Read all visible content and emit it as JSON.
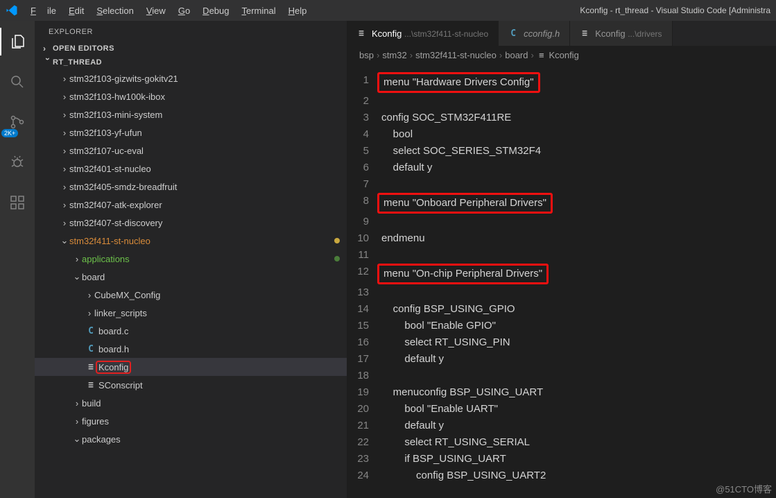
{
  "window": {
    "title": "Kconfig - rt_thread - Visual Studio Code [Administra"
  },
  "menu": {
    "file": "File",
    "edit": "Edit",
    "selection": "Selection",
    "view": "View",
    "go": "Go",
    "debug": "Debug",
    "terminal": "Terminal",
    "help": "Help"
  },
  "activity": {
    "scm_badge": "2K+"
  },
  "explorer": {
    "title": "EXPLORER",
    "open_editors": "OPEN EDITORS",
    "root": "RT_THREAD",
    "tree": [
      {
        "i": 2,
        "tw": ">",
        "txt": "stm32f103-gizwits-gokitv21"
      },
      {
        "i": 2,
        "tw": ">",
        "txt": "stm32f103-hw100k-ibox"
      },
      {
        "i": 2,
        "tw": ">",
        "txt": "stm32f103-mini-system"
      },
      {
        "i": 2,
        "tw": ">",
        "txt": "stm32f103-yf-ufun"
      },
      {
        "i": 2,
        "tw": ">",
        "txt": "stm32f107-uc-eval"
      },
      {
        "i": 2,
        "tw": ">",
        "txt": "stm32f401-st-nucleo"
      },
      {
        "i": 2,
        "tw": ">",
        "txt": "stm32f405-smdz-breadfruit"
      },
      {
        "i": 2,
        "tw": ">",
        "txt": "stm32f407-atk-explorer"
      },
      {
        "i": 2,
        "tw": ">",
        "txt": "stm32f407-st-discovery"
      },
      {
        "i": 2,
        "tw": "v",
        "txt": "stm32f411-st-nucleo",
        "cls": "hl-orange",
        "dot": "dot-y"
      },
      {
        "i": 3,
        "tw": ">",
        "txt": "applications",
        "cls": "hl-green",
        "dot": "dot-g"
      },
      {
        "i": 3,
        "tw": "v",
        "txt": "board"
      },
      {
        "i": 4,
        "tw": ">",
        "txt": "CubeMX_Config"
      },
      {
        "i": 4,
        "tw": ">",
        "txt": "linker_scripts"
      },
      {
        "i": 4,
        "ic": "C",
        "icc": "#519aba",
        "txt": "board.c"
      },
      {
        "i": 4,
        "ic": "C",
        "icc": "#519aba",
        "txt": "board.h"
      },
      {
        "i": 4,
        "ic": "≡",
        "icc": "#c5c5c5",
        "txt": "Kconfig",
        "sel": true,
        "box": true
      },
      {
        "i": 4,
        "ic": "≡",
        "icc": "#c5c5c5",
        "txt": "SConscript"
      },
      {
        "i": 3,
        "tw": ">",
        "txt": "build"
      },
      {
        "i": 3,
        "tw": ">",
        "txt": "figures"
      },
      {
        "i": 3,
        "tw": "v",
        "txt": "packages"
      }
    ]
  },
  "tabs": [
    {
      "ic": "≡",
      "icc": "#c5c5c5",
      "label": "Kconfig",
      "suffix": "...\\stm32f411-st-nucleo",
      "active": true
    },
    {
      "ic": "C",
      "icc": "#519aba",
      "label": "cconfig.h",
      "italic": true
    },
    {
      "ic": "≡",
      "icc": "#c5c5c5",
      "label": "Kconfig",
      "suffix": "...\\drivers"
    }
  ],
  "breadcrumbs": [
    "bsp",
    "stm32",
    "stm32f411-st-nucleo",
    "board",
    "Kconfig"
  ],
  "code": [
    {
      "n": 1,
      "t": "menu \"Hardware Drivers Config\"",
      "box": true,
      "ind": 0
    },
    {
      "n": 2,
      "t": "",
      "ind": 0
    },
    {
      "n": 3,
      "t": "config SOC_STM32F411RE",
      "ind": 0
    },
    {
      "n": 4,
      "t": "    bool",
      "ind": 0
    },
    {
      "n": 5,
      "t": "    select SOC_SERIES_STM32F4",
      "ind": 0
    },
    {
      "n": 6,
      "t": "    default y",
      "ind": 0
    },
    {
      "n": 7,
      "t": "",
      "ind": 0
    },
    {
      "n": 8,
      "t": "menu \"Onboard Peripheral Drivers\"",
      "box": true,
      "ind": 0
    },
    {
      "n": 9,
      "t": "",
      "ind": 0
    },
    {
      "n": 10,
      "t": "endmenu",
      "ind": 0
    },
    {
      "n": 11,
      "t": "",
      "ind": 0
    },
    {
      "n": 12,
      "t": "menu \"On-chip Peripheral Drivers\"",
      "box": true,
      "ind": 0
    },
    {
      "n": 13,
      "t": "",
      "ind": 0
    },
    {
      "n": 14,
      "t": "    config BSP_USING_GPIO",
      "ind": 0
    },
    {
      "n": 15,
      "t": "        bool \"Enable GPIO\"",
      "ind": 0
    },
    {
      "n": 16,
      "t": "        select RT_USING_PIN",
      "ind": 0
    },
    {
      "n": 17,
      "t": "        default y",
      "ind": 0
    },
    {
      "n": 18,
      "t": "",
      "ind": 0
    },
    {
      "n": 19,
      "t": "    menuconfig BSP_USING_UART",
      "ind": 0
    },
    {
      "n": 20,
      "t": "        bool \"Enable UART\"",
      "ind": 0
    },
    {
      "n": 21,
      "t": "        default y",
      "ind": 0
    },
    {
      "n": 22,
      "t": "        select RT_USING_SERIAL",
      "ind": 0
    },
    {
      "n": 23,
      "t": "        if BSP_USING_UART",
      "ind": 0
    },
    {
      "n": 24,
      "t": "            config BSP_USING_UART2",
      "ind": 0
    }
  ],
  "watermark": "@51CTO博客"
}
